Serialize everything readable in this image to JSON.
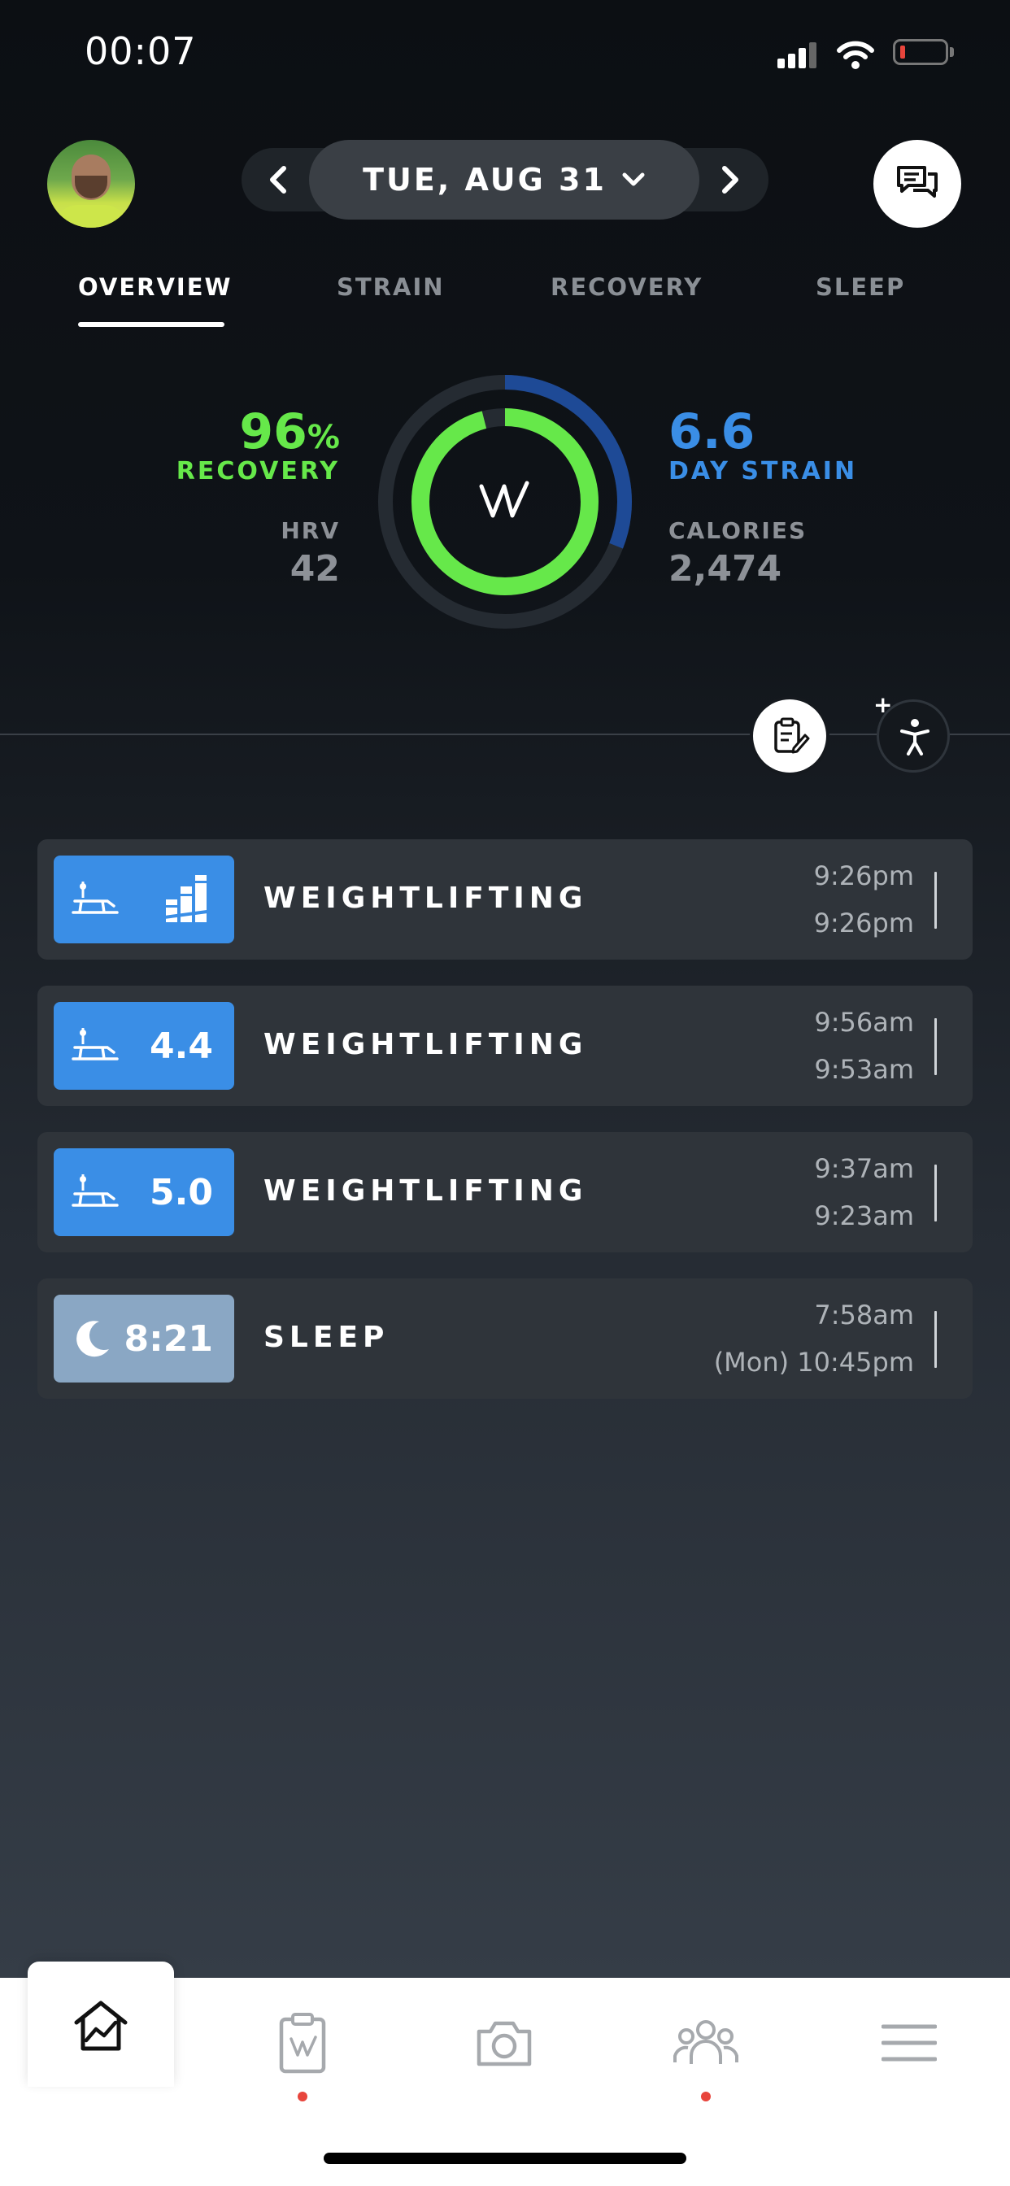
{
  "status_bar": {
    "time": "00:07"
  },
  "header": {
    "date_label": "TUE, AUG 31"
  },
  "tabs": [
    "OVERVIEW",
    "STRAIN",
    "RECOVERY",
    "SLEEP"
  ],
  "summary": {
    "recovery_value": "96",
    "recovery_unit": "%",
    "recovery_label": "RECOVERY",
    "hrv_label": "HRV",
    "hrv_value": "42",
    "strain_value": "6.6",
    "strain_label": "DAY STRAIN",
    "calories_label": "CALORIES",
    "calories_value": "2,474",
    "recovery_fraction": 0.96,
    "strain_fraction": 0.31
  },
  "activities": [
    {
      "badge_value": "",
      "title": "WEIGHTLIFTING",
      "time_end": "9:26pm",
      "time_start": "9:26pm",
      "type": "weightlifting"
    },
    {
      "badge_value": "4.4",
      "title": "WEIGHTLIFTING",
      "time_end": "9:56am",
      "time_start": "9:53am",
      "type": "weightlifting"
    },
    {
      "badge_value": "5.0",
      "title": "WEIGHTLIFTING",
      "time_end": "9:37am",
      "time_start": "9:23am",
      "type": "weightlifting"
    },
    {
      "badge_value": "8:21",
      "title": "SLEEP",
      "time_end": "7:58am",
      "time_start": "(Mon) 10:45pm",
      "type": "sleep"
    }
  ],
  "colors": {
    "recovery_green": "#66e84a",
    "strain_blue": "#3a8ee6",
    "sleep_badge": "#8aa7c4",
    "notification_dot": "#e8453c"
  },
  "icons": [
    "signal-icon",
    "wifi-icon",
    "battery-icon",
    "chevron-left-icon",
    "chevron-down-icon",
    "chevron-right-icon",
    "chat-icon",
    "whoop-logo-icon",
    "journal-icon",
    "add-activity-icon",
    "weightlifting-icon",
    "bars-pending-icon",
    "moon-icon",
    "home-icon",
    "whoop-clipboard-icon",
    "camera-icon",
    "community-icon",
    "menu-icon"
  ]
}
